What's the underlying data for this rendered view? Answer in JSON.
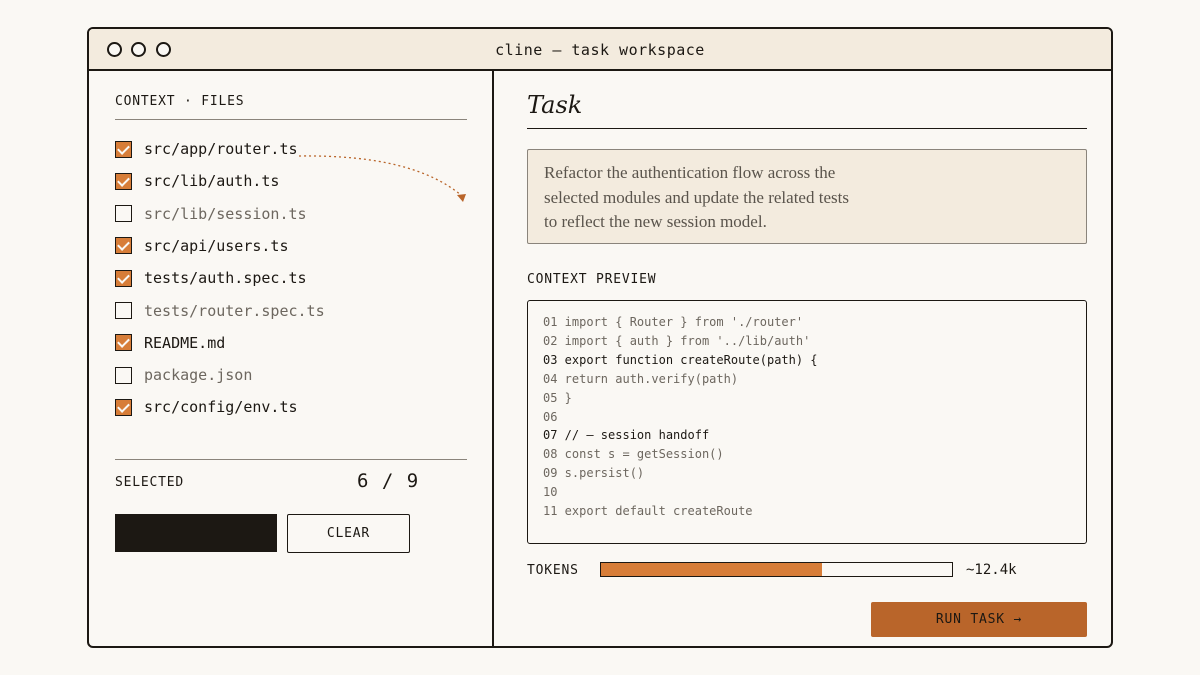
{
  "window": {
    "title": "cline — task workspace"
  },
  "files": {
    "label": "CONTEXT · FILES",
    "items": [
      {
        "name": "src/app/router.ts",
        "checked": true
      },
      {
        "name": "src/lib/auth.ts",
        "checked": true
      },
      {
        "name": "src/lib/session.ts",
        "checked": false
      },
      {
        "name": "src/api/users.ts",
        "checked": true
      },
      {
        "name": "tests/auth.spec.ts",
        "checked": true
      },
      {
        "name": "tests/router.spec.ts",
        "checked": false
      },
      {
        "name": "README.md",
        "checked": true
      },
      {
        "name": "package.json",
        "checked": false
      },
      {
        "name": "src/config/env.ts",
        "checked": true
      }
    ]
  },
  "selection": {
    "label": "SELECTED",
    "count": "6 / 9"
  },
  "actions": {
    "clear_label": "CLEAR",
    "run_label": "RUN TASK →"
  },
  "task": {
    "heading": "Task",
    "lines": [
      "Refactor the authentication flow across the",
      "selected modules and update the related tests",
      "to reflect the new session model."
    ]
  },
  "preview": {
    "label": "CONTEXT PREVIEW",
    "lines": [
      {
        "text": "01 import { Router } from './router'",
        "highlight": false
      },
      {
        "text": "02 import { auth } from '../lib/auth'",
        "highlight": false
      },
      {
        "text": "03 export function createRoute(path) {",
        "highlight": true
      },
      {
        "text": "04 return auth.verify(path)",
        "highlight": false
      },
      {
        "text": "05 }",
        "highlight": false
      },
      {
        "text": "06",
        "highlight": false
      },
      {
        "text": "07 // — session handoff",
        "highlight": true
      },
      {
        "text": "08 const s = getSession()",
        "highlight": false
      },
      {
        "text": "09 s.persist()",
        "highlight": false
      },
      {
        "text": "10",
        "highlight": false
      },
      {
        "text": "11 export default createRoute",
        "highlight": false
      }
    ]
  },
  "tokens": {
    "label": "TOKENS",
    "value": "~12.4k",
    "fill_fraction": 0.63
  },
  "colors": {
    "accent": "#d77d38",
    "run_button": "#b9652a",
    "ink": "#1c1813",
    "paper": "#faf8f4",
    "panel": "#f3ebde"
  }
}
